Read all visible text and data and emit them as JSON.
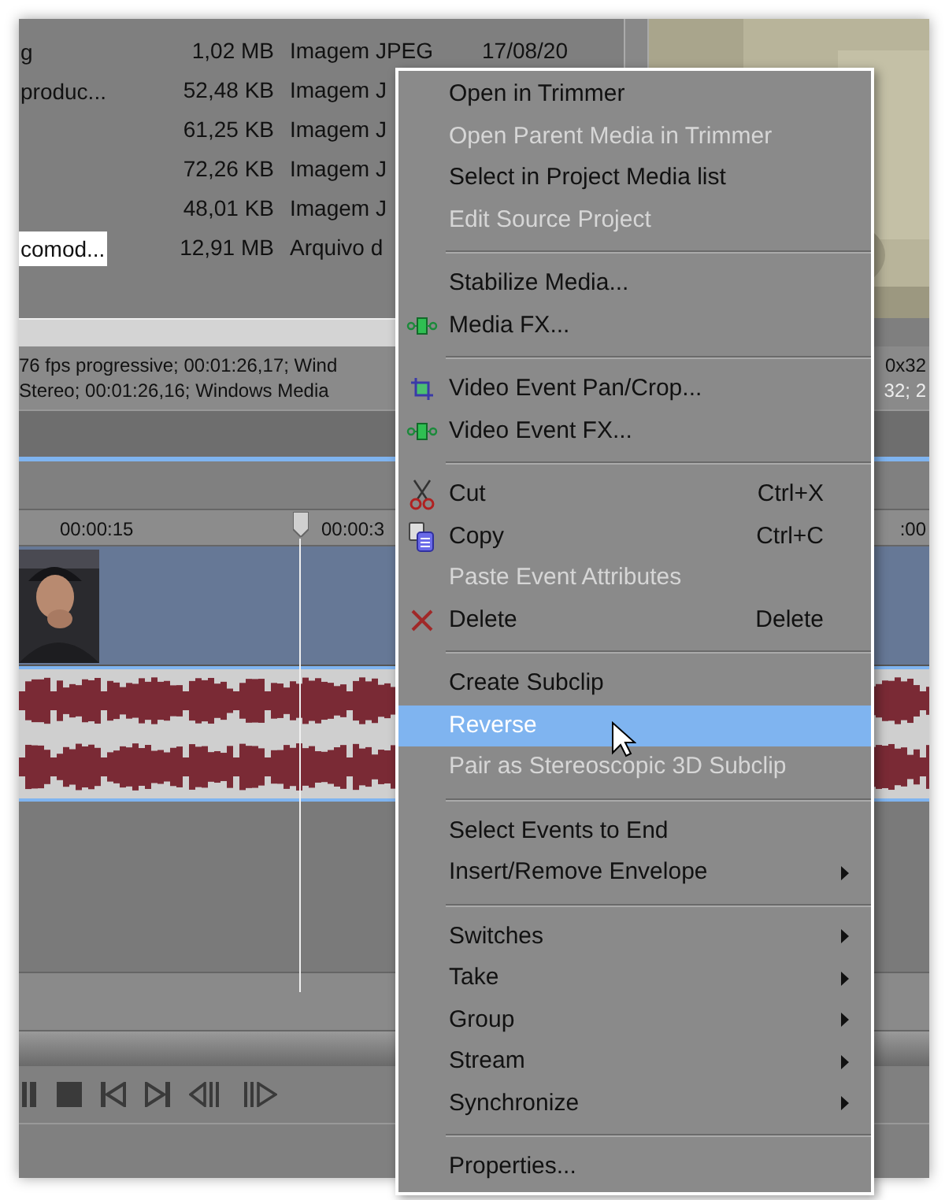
{
  "media_list": {
    "rows": [
      {
        "name": "g",
        "size": "1,02 MB",
        "type": "Imagem JPEG",
        "date": "17/08/20",
        "selected": false
      },
      {
        "name": "produc...",
        "size": "52,48 KB",
        "type": "Imagem J",
        "selected": false
      },
      {
        "size": "61,25 KB",
        "type": "Imagem J",
        "selected": false
      },
      {
        "size": "72,26 KB",
        "type": "Imagem J",
        "selected": false
      },
      {
        "size": "48,01 KB",
        "type": "Imagem J",
        "selected": false
      },
      {
        "name": "comod...",
        "size": "12,91 MB",
        "type": "Arquivo d",
        "selected": true
      }
    ]
  },
  "media_info": {
    "lines": [
      "76 fps progressive; 00:01:26,17; Wind",
      "Stereo; 00:01:26,16; Windows Media"
    ]
  },
  "preview_info": {
    "lines": [
      "0x32",
      "32; 2"
    ]
  },
  "timeline": {
    "ruler": [
      "00:00:15",
      "00:00:3",
      ":00"
    ]
  },
  "context_menu": {
    "items": [
      {
        "kind": "item",
        "label": "Open in Trimmer",
        "disabled": false,
        "selected": false
      },
      {
        "kind": "item",
        "label": "Open Parent Media in Trimmer",
        "disabled": true,
        "selected": false
      },
      {
        "kind": "item",
        "label": "Select in Project Media list",
        "disabled": false,
        "selected": false
      },
      {
        "kind": "item",
        "label": "Edit Source Project",
        "disabled": true,
        "selected": false
      },
      {
        "kind": "separator"
      },
      {
        "kind": "item",
        "label": "Stabilize Media...",
        "disabled": false,
        "selected": false
      },
      {
        "kind": "item",
        "label": "Media FX...",
        "disabled": false,
        "selected": false
      },
      {
        "kind": "separator"
      },
      {
        "kind": "item",
        "label": "Video Event Pan/Crop...",
        "disabled": false,
        "selected": false
      },
      {
        "kind": "item",
        "label": "Video Event FX...",
        "disabled": false,
        "selected": false
      },
      {
        "kind": "separator"
      },
      {
        "kind": "item",
        "label": "Cut",
        "shortcut": "Ctrl+X",
        "disabled": false,
        "selected": false
      },
      {
        "kind": "item",
        "label": "Copy",
        "shortcut": "Ctrl+C",
        "disabled": false,
        "selected": false
      },
      {
        "kind": "item",
        "label": "Paste Event Attributes",
        "disabled": true,
        "selected": false
      },
      {
        "kind": "item",
        "label": "Delete",
        "shortcut": "Delete",
        "disabled": false,
        "selected": false
      },
      {
        "kind": "separator"
      },
      {
        "kind": "item",
        "label": "Create Subclip",
        "disabled": false,
        "selected": false
      },
      {
        "kind": "item",
        "label": "Reverse",
        "disabled": false,
        "selected": true
      },
      {
        "kind": "item",
        "label": "Pair as Stereoscopic 3D Subclip",
        "disabled": true,
        "selected": false
      },
      {
        "kind": "separator"
      },
      {
        "kind": "item",
        "label": "Select Events to End",
        "disabled": false,
        "selected": false
      },
      {
        "kind": "item",
        "label": "Insert/Remove Envelope",
        "submenu": true,
        "disabled": false,
        "selected": false
      },
      {
        "kind": "separator"
      },
      {
        "kind": "item",
        "label": "Switches",
        "submenu": true,
        "disabled": false,
        "selected": false
      },
      {
        "kind": "item",
        "label": "Take",
        "submenu": true,
        "disabled": false,
        "selected": false
      },
      {
        "kind": "item",
        "label": "Group",
        "submenu": true,
        "disabled": false,
        "selected": false
      },
      {
        "kind": "item",
        "label": "Stream",
        "submenu": true,
        "disabled": false,
        "selected": false
      },
      {
        "kind": "item",
        "label": "Synchronize",
        "submenu": true,
        "disabled": false,
        "selected": false
      },
      {
        "kind": "separator"
      },
      {
        "kind": "item",
        "label": "Properties...",
        "disabled": false,
        "selected": false
      }
    ]
  }
}
